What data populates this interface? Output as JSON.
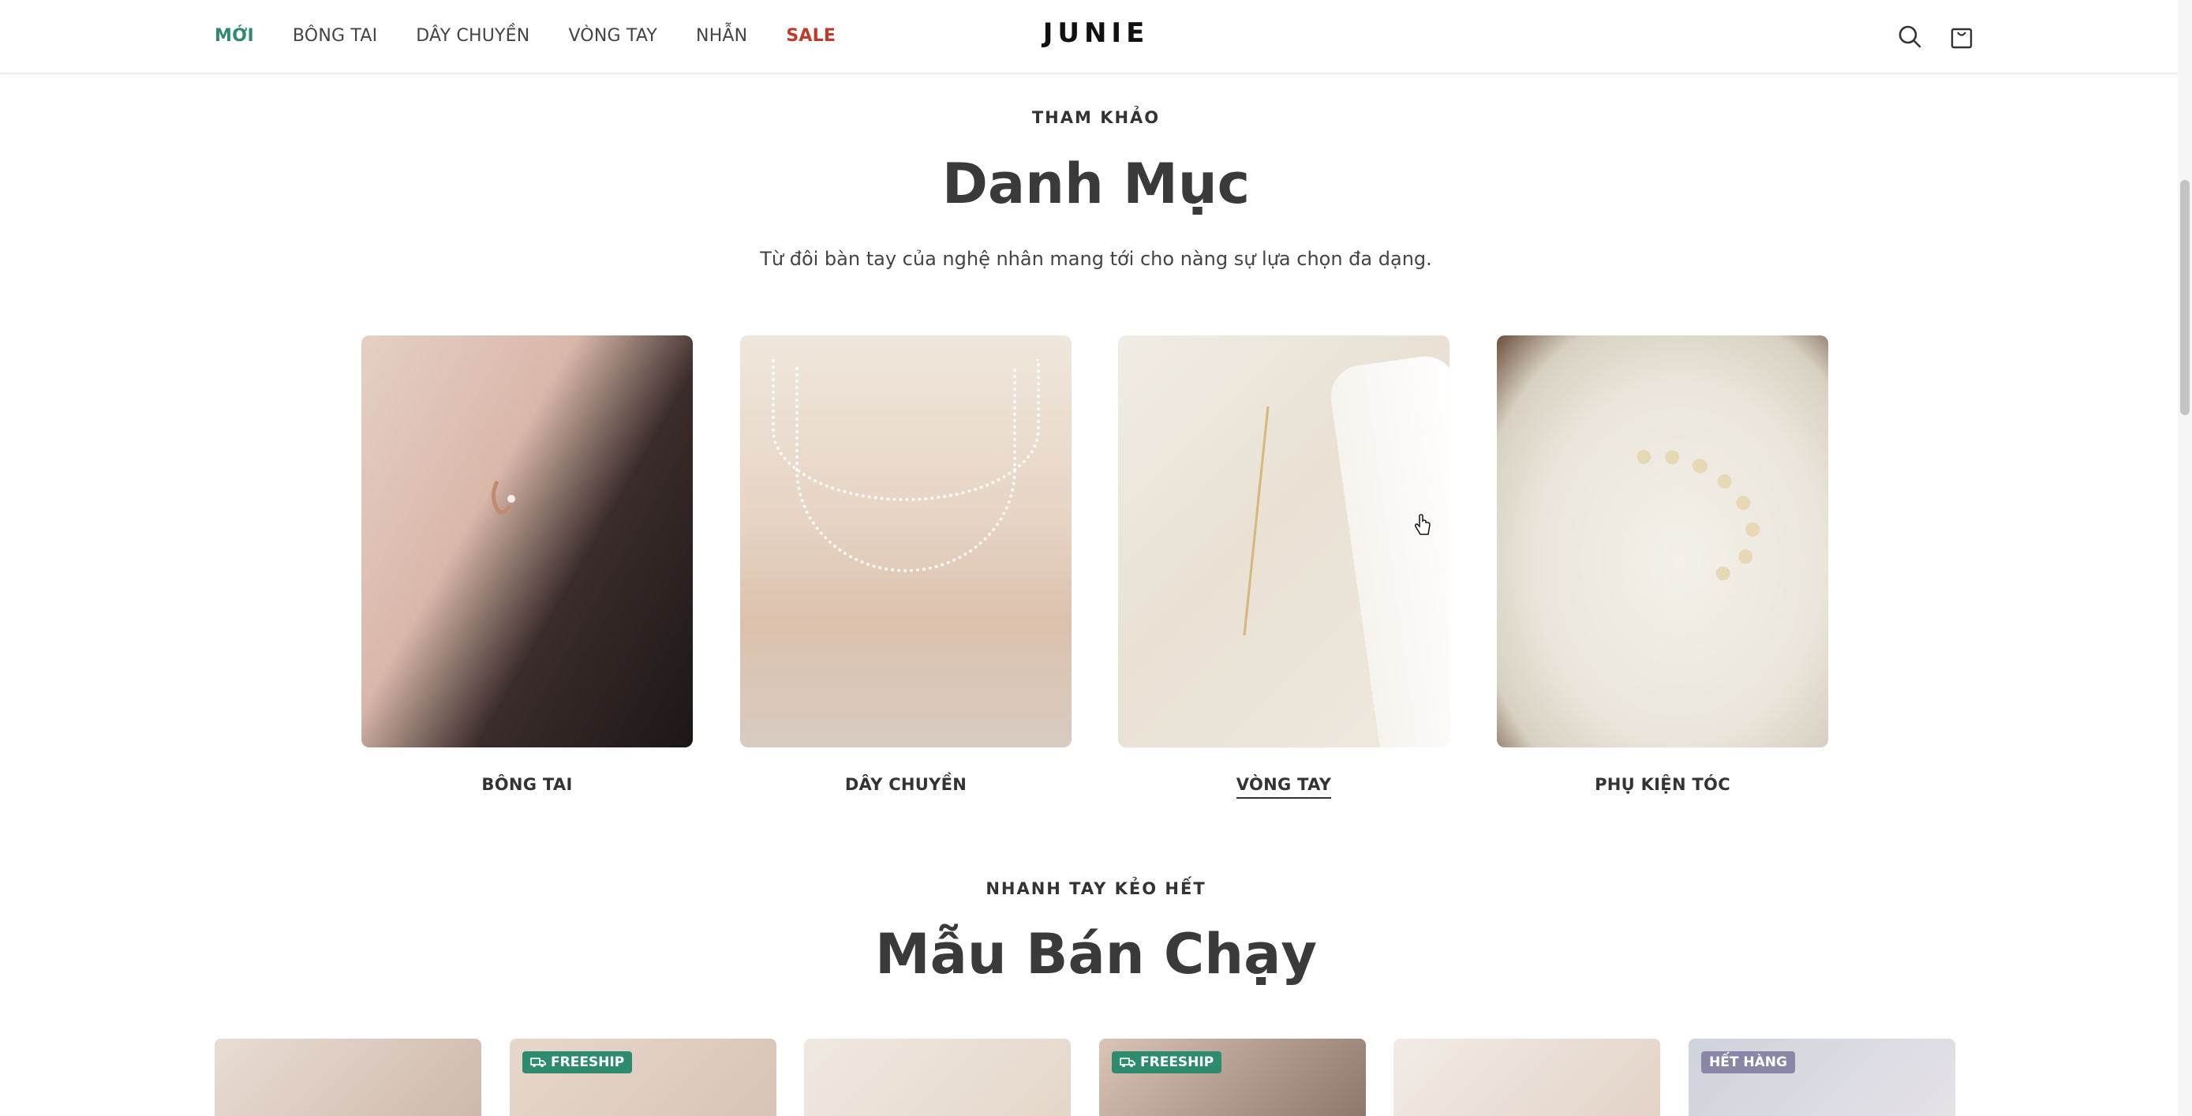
{
  "nav": {
    "items": [
      {
        "label": "MỚI",
        "style": "new"
      },
      {
        "label": "BÔNG TAI",
        "style": ""
      },
      {
        "label": "DÂY CHUYỀN",
        "style": ""
      },
      {
        "label": "VÒNG TAY",
        "style": ""
      },
      {
        "label": "NHẪN",
        "style": ""
      },
      {
        "label": "SALE",
        "style": "sale"
      }
    ],
    "logo": "JUNIE",
    "icons": [
      "search-icon",
      "shopping-bag-icon"
    ]
  },
  "categories": {
    "eyebrow": "THAM KHẢO",
    "title": "Danh Mục",
    "subtitle": "Từ đôi bàn tay của nghệ nhân mang tới cho nàng sự lựa chọn đa dạng.",
    "items": [
      {
        "label": "BÔNG TAI"
      },
      {
        "label": "DÂY CHUYỀN"
      },
      {
        "label": "VÒNG TAY"
      },
      {
        "label": "PHỤ KIỆN TÓC"
      }
    ]
  },
  "bestsellers": {
    "eyebrow": "NHANH TAY KẺO HẾT",
    "title": "Mẫu Bán Chạy",
    "products": [
      {
        "badge": ""
      },
      {
        "badge": "FREESHIP"
      },
      {
        "badge": ""
      },
      {
        "badge": "FREESHIP"
      },
      {
        "badge": ""
      },
      {
        "badge": "HẾT HÀNG"
      }
    ]
  },
  "colors": {
    "accent_green": "#2e8b6e",
    "sale_red": "#c0392b",
    "sold_out_badge": "#8a86a8",
    "text_dark": "#333333"
  }
}
